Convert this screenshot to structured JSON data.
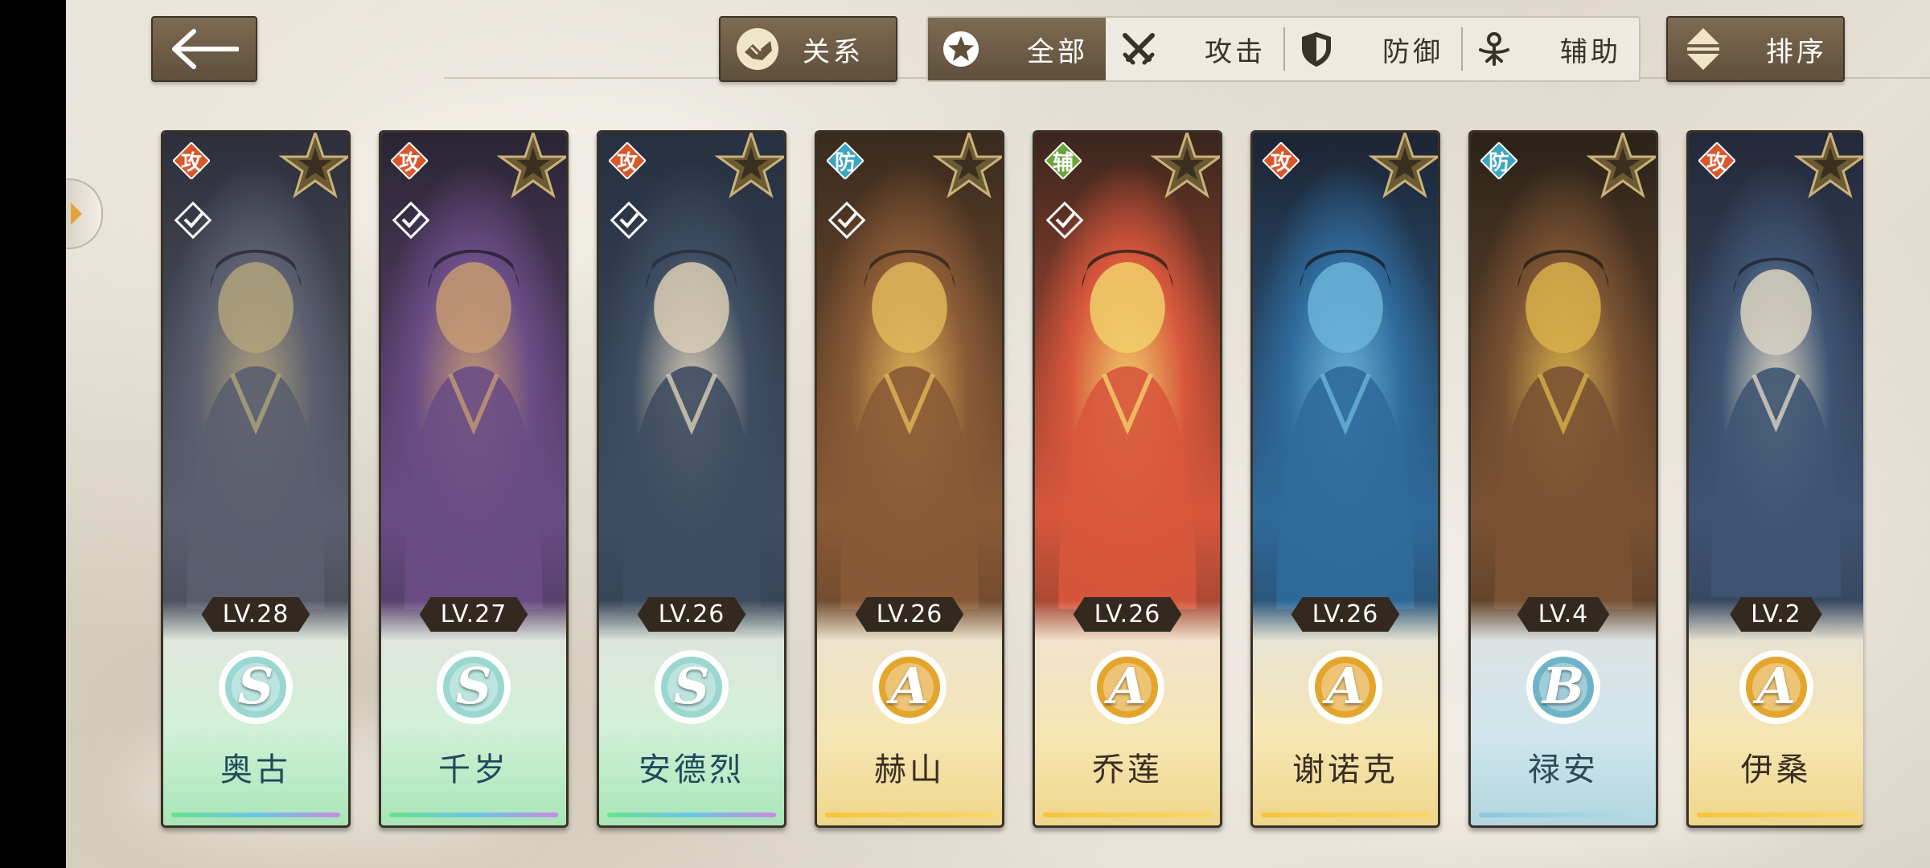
{
  "topbar": {
    "relation_label": "关系",
    "sort_label": "排序",
    "filters": [
      {
        "label": "全部",
        "icon": "star-circle-icon",
        "active": true
      },
      {
        "label": "攻击",
        "icon": "crossed-swords-icon",
        "active": false
      },
      {
        "label": "防御",
        "icon": "shield-icon",
        "active": false
      },
      {
        "label": "辅助",
        "icon": "support-figure-icon",
        "active": false
      }
    ]
  },
  "colors": {
    "role_attack": "#d8582c",
    "role_defense": "#3aa6c0",
    "role_support": "#6aa33a",
    "rank_s": "#9ad7d0",
    "rank_a": "#e3a52c",
    "rank_b": "#6fb3c6"
  },
  "characters": [
    {
      "name": "奥古",
      "level": "LV.28",
      "role": "攻",
      "role_type": "attack",
      "rank": "S",
      "frame": "rainbow",
      "palette": [
        "#2d2f3b",
        "#5a5e6e",
        "#b0a27d"
      ]
    },
    {
      "name": "千岁",
      "level": "LV.27",
      "role": "攻",
      "role_type": "attack",
      "rank": "S",
      "frame": "rainbow",
      "palette": [
        "#2a2533",
        "#6a4c84",
        "#c59a72"
      ]
    },
    {
      "name": "安德烈",
      "level": "LV.26",
      "role": "攻",
      "role_type": "attack",
      "rank": "S",
      "frame": "rainbow",
      "palette": [
        "#263041",
        "#3e4d62",
        "#d9cdb5"
      ]
    },
    {
      "name": "赫山",
      "level": "LV.26",
      "role": "防",
      "role_type": "defense",
      "rank": "A",
      "frame": "gold",
      "palette": [
        "#3a2a1d",
        "#8a5a36",
        "#e2b65a"
      ]
    },
    {
      "name": "乔莲",
      "level": "LV.26",
      "role": "辅",
      "role_type": "support",
      "rank": "A",
      "frame": "gold",
      "palette": [
        "#3a261d",
        "#d7563c",
        "#f1cf6a"
      ]
    },
    {
      "name": "谢诺克",
      "level": "LV.26",
      "role": "攻",
      "role_type": "attack",
      "rank": "A",
      "frame": "gold",
      "palette": [
        "#1d2433",
        "#2f6a9a",
        "#6bb4d8"
      ]
    },
    {
      "name": "禄安",
      "level": "LV.4",
      "role": "防",
      "role_type": "defense",
      "rank": "B",
      "frame": "blue",
      "palette": [
        "#2b2218",
        "#7a5233",
        "#d8b04a"
      ]
    },
    {
      "name": "伊桑",
      "level": "LV.2",
      "role": "攻",
      "role_type": "attack",
      "rank": "A",
      "frame": "gold",
      "palette": [
        "#24293a",
        "#3e5472",
        "#d9d2c1"
      ]
    }
  ]
}
